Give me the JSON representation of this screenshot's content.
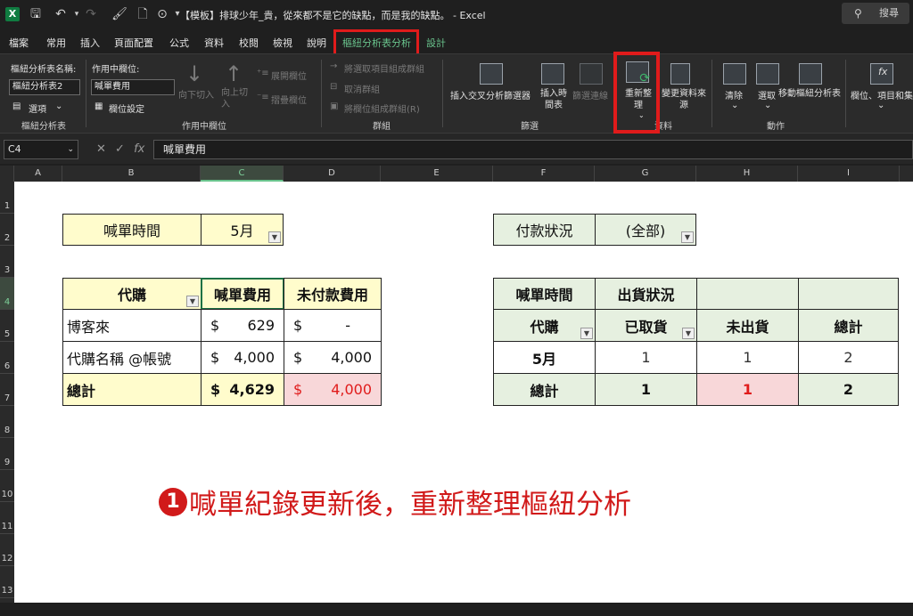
{
  "window": {
    "app_icon": "X",
    "title": "【模板】排球少年_貴，從來都不是它的缺點，而是我的缺點。 - Excel",
    "search_label": "搜尋"
  },
  "tabs": [
    "檔案",
    "常用",
    "插入",
    "頁面配置",
    "公式",
    "資料",
    "校閱",
    "檢視",
    "說明",
    "樞紐分析表分析",
    "設計"
  ],
  "active_tab": "樞紐分析表分析",
  "ribbon": {
    "pivot_name_label": "樞紐分析表名稱:",
    "pivot_name_value": "樞紐分析表2",
    "options_label": "選項",
    "group_pivot": "樞紐分析表",
    "active_field_label": "作用中欄位:",
    "active_field_value": "喊單費用",
    "field_settings": "欄位設定",
    "drill_down": "向下切入",
    "drill_up": "向上切入",
    "expand_field": "展開欄位",
    "collapse_field": "摺疊欄位",
    "group_active_field": "作用中欄位",
    "group_selection": "將選取項目組成群組",
    "ungroup": "取消群組",
    "group_field": "將欄位組成群組(R)",
    "group_group": "群組",
    "insert_slicer": "插入交叉分析篩選器",
    "insert_timeline": "插入時間表",
    "filter_connections": "篩選連線",
    "group_filter": "篩選",
    "refresh": "重新整理",
    "change_source": "變更資料來源",
    "group_data": "資料",
    "clear": "清除",
    "select": "選取",
    "move_pivot": "移動樞紐分析表",
    "group_actions": "動作",
    "fields_items": "欄位、項目和集"
  },
  "formula_bar": {
    "name_box": "C4",
    "formula": "喊單費用"
  },
  "columns": [
    "A",
    "B",
    "C",
    "D",
    "E",
    "F",
    "G",
    "H",
    "I"
  ],
  "selected_column": "C",
  "rows": [
    "1",
    "2",
    "3",
    "4",
    "5",
    "6",
    "7",
    "8",
    "9",
    "10",
    "11",
    "12",
    "13"
  ],
  "selected_row": "4",
  "left_pivot": {
    "filter_label": "喊單時間",
    "filter_value": "5月",
    "header_agent": "代購",
    "header_fee": "喊單費用",
    "header_unpaid": "未付款費用",
    "rows": [
      {
        "agent": "博客來",
        "fee_sym": "$",
        "fee": "629",
        "unpaid_sym": "$",
        "unpaid": "-"
      },
      {
        "agent": "代購名稱 @帳號",
        "fee_sym": "$",
        "fee": "4,000",
        "unpaid_sym": "$",
        "unpaid": "4,000"
      }
    ],
    "total": {
      "agent": "總計",
      "fee_sym": "$",
      "fee": "4,629",
      "unpaid_sym": "$",
      "unpaid": "4,000"
    }
  },
  "right_pivot": {
    "filter_label": "付款狀況",
    "filter_value": "(全部)",
    "row_header": "喊單時間",
    "col_header": "出貨狀況",
    "sub_agent": "代購",
    "sub_picked": "已取貨",
    "sub_unshipped": "未出貨",
    "sub_total": "總計",
    "row_may": {
      "label": "5月",
      "picked": "1",
      "unshipped": "1",
      "total": "2"
    },
    "row_total": {
      "label": "總計",
      "picked": "1",
      "unshipped": "1",
      "total": "2"
    }
  },
  "annotation": {
    "number": "1",
    "text": "喊單紀錄更新後，重新整理樞紐分析"
  },
  "colors": {
    "accent": "#6ac48d",
    "highlight_red": "#e01b1b",
    "yellow_fill": "#fffccc",
    "green_fill": "#e6f0e0",
    "pink_fill": "#f8d7d9"
  }
}
